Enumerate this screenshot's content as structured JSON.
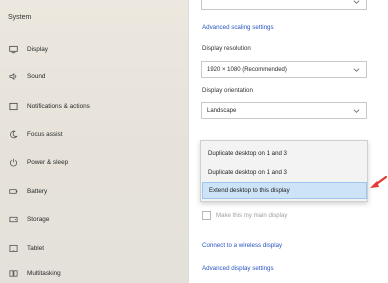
{
  "sidebar": {
    "title": "System",
    "items": [
      {
        "label": "Display",
        "icon": "monitor-icon"
      },
      {
        "label": "Sound",
        "icon": "sound-icon"
      },
      {
        "label": "Notifications & actions",
        "icon": "notifications-icon"
      },
      {
        "label": "Focus assist",
        "icon": "moon-icon"
      },
      {
        "label": "Power & sleep",
        "icon": "power-icon"
      },
      {
        "label": "Battery",
        "icon": "battery-icon"
      },
      {
        "label": "Storage",
        "icon": "storage-icon"
      },
      {
        "label": "Tablet",
        "icon": "tablet-icon"
      },
      {
        "label": "Multitasking",
        "icon": "multitasking-icon"
      }
    ]
  },
  "main": {
    "top_dropdown_value": "",
    "advanced_scaling_link": "Advanced scaling settings",
    "resolution_label": "Display resolution",
    "resolution_value": "1920 × 1080 (Recommended)",
    "orientation_label": "Display orientation",
    "orientation_value": "Landscape",
    "multiple_displays_options": [
      "Duplicate desktop on 1 and 3",
      "Duplicate desktop on 1 and 3",
      "Extend desktop to this display"
    ],
    "selected_option_index": 2,
    "main_display_checkbox_label": "Make this my main display",
    "wireless_link": "Connect to a wireless display",
    "advanced_display_link": "Advanced display settings"
  },
  "colors": {
    "accent": "#2a55c0",
    "highlight": "#cde3f7",
    "arrow": "#e53935"
  }
}
